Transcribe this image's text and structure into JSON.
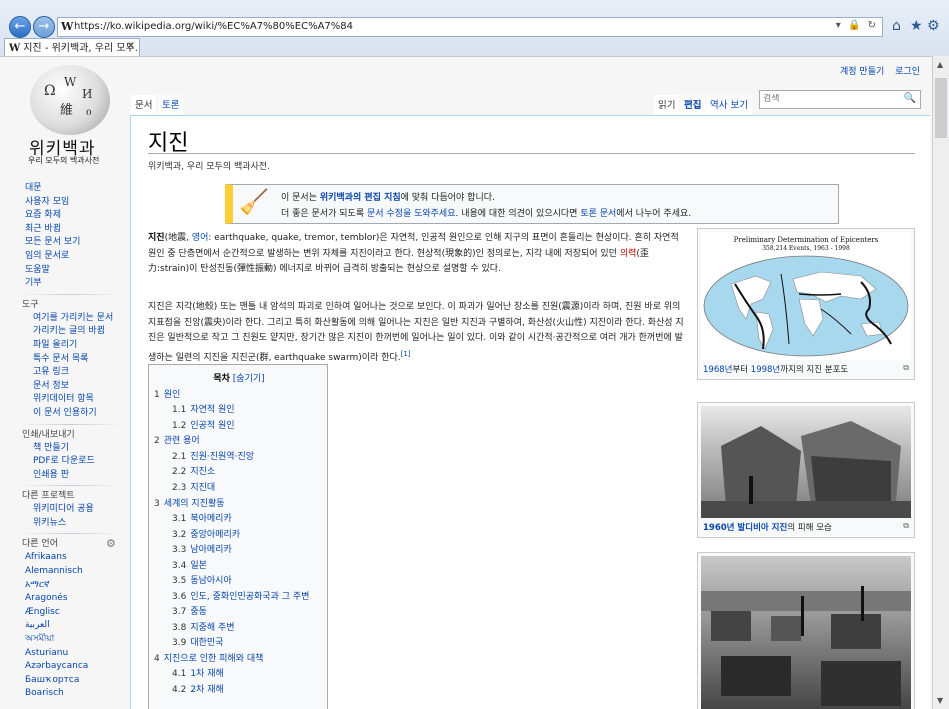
{
  "browser": {
    "url": "https://ko.wikipedia.org/wiki/%EC%A7%80%EC%A7%84",
    "url_controls": "▾ 🔒 ↻",
    "tab_title": "지진 - 위키백과, 우리 모두...",
    "tab_close": "✕",
    "back": "←",
    "forward": "→",
    "home_icon": "⌂",
    "fav_icon": "★",
    "settings_icon": "⚙"
  },
  "header": {
    "user_links": [
      "계정 만들기",
      "로그인"
    ],
    "ns_tabs": [
      "문서",
      "토론"
    ],
    "view_tabs": [
      "읽기",
      "편집",
      "역사 보기"
    ],
    "search_placeholder": "검색"
  },
  "sidebar": {
    "wiki_name": "위키백과",
    "wiki_sub": "우리 모두의 백과사전",
    "nav": [
      "대문",
      "사용자 모임",
      "요즘 화제",
      "최근 바뀜",
      "모든 문서 보기",
      "임의 문서로",
      "도움말",
      "기부"
    ],
    "tools_heading": "도구",
    "tools": [
      "여기를 가리키는 문서",
      "가리키는 글의 바뀜",
      "파일 올리기",
      "특수 문서 목록",
      "고유 링크",
      "문서 정보",
      "위키데이터 항목",
      "이 문서 인용하기"
    ],
    "print_heading": "인쇄/내보내기",
    "print": [
      "책 만들기",
      "PDF로 다운로드",
      "인쇄용 판"
    ],
    "projects_heading": "다른 프로젝트",
    "projects": [
      "위키미디어 공용",
      "위키뉴스"
    ],
    "lang_heading": "다른 언어",
    "languages": [
      "Afrikaans",
      "Alemannisch",
      "አማርኛ",
      "Aragonés",
      "Ænglisc",
      "العربية",
      "অসমীয়া",
      "Asturianu",
      "Azərbaycanca",
      "Башҡортса",
      "Boarisch"
    ]
  },
  "article": {
    "title": "지진",
    "tagline": "위키백과, 우리 모두의 백과사전.",
    "notice_line1_pre": "이 문서는 ",
    "notice_line1_link": "위키백과의 편집 지침",
    "notice_line1_post": "에 맞춰 다듬어야 합니다.",
    "notice_line2_pre": "더 좋은 문서가 되도록 ",
    "notice_line2_link1": "문서 수정을 도와주세요",
    "notice_line2_mid": ". 내용에 대한 의견이 있으시다면 ",
    "notice_line2_link2": "토론 문서",
    "notice_line2_post": "에서 나누어 주세요.",
    "p1_bold": "지진",
    "p1_a": "(地震, ",
    "p1_link": "영어",
    "p1_b": ": earthquake, quake, tremor, temblor)은 자연적, 인공적 원인으로 인해 지구의 표면이 흔들리는 현상이다. 흔히 자연적 원인 중 단층면에서 순간적으로 발생하는 변위 자체를 지진이라고 한다. 현상적(現象的)인 정의로는, 지각 내에 저장되어 있던 ",
    "p1_red": "의력",
    "p1_c": "(歪力:strain)이 탄성진동(彈性振動) 에너지로 바뀌어 급격히 방출되는 현상으로 설명할 수 있다.",
    "p2": "지진은 지각(地殼) 또는 맨틀 내 암석의 파괴로 인하여 일어나는 것으로 보인다. 이 파괴가 일어난 장소를 진원(震源)이라 하며, 진원 바로 위의 지표점을 진앙(震央)이라 한다. 그리고 특히 화산활동에 의해 일어나는 지진은 일반 지진과 구별하여, 화산성(火山性) 지진이라 한다. 화산성 지진은 일반적으로 작고 그 진원도 얕지만, 장기간 많은 지진이 한꺼번에 일어나는 일이 있다. 이와 같이 시간적·공간적으로 여러 개가 한꺼번에 발생하는 일련의 지진을 지진군(群, earthquake swarm)이라 한다.",
    "p2_ref": "[1]"
  },
  "toc": {
    "title": "목차",
    "toggle": "[숨기기]",
    "items": [
      {
        "num": "1",
        "label": "원인",
        "level": 1
      },
      {
        "num": "1.1",
        "label": "자연적 원인",
        "level": 2
      },
      {
        "num": "1.2",
        "label": "인공적 원인",
        "level": 2
      },
      {
        "num": "2",
        "label": "관련 용어",
        "level": 1
      },
      {
        "num": "2.1",
        "label": "진원·진원역·진앙",
        "level": 2
      },
      {
        "num": "2.2",
        "label": "지진소",
        "level": 2
      },
      {
        "num": "2.3",
        "label": "지진대",
        "level": 2
      },
      {
        "num": "3",
        "label": "세계의 지진활동",
        "level": 1
      },
      {
        "num": "3.1",
        "label": "북아메리카",
        "level": 2
      },
      {
        "num": "3.2",
        "label": "중앙아메리카",
        "level": 2
      },
      {
        "num": "3.3",
        "label": "남아메리카",
        "level": 2
      },
      {
        "num": "3.4",
        "label": "일본",
        "level": 2
      },
      {
        "num": "3.5",
        "label": "동남아시아",
        "level": 2
      },
      {
        "num": "3.6",
        "label": "인도, 중화인민공화국과 그 주변",
        "level": 2
      },
      {
        "num": "3.7",
        "label": "중동",
        "level": 2
      },
      {
        "num": "3.8",
        "label": "지중해 주변",
        "level": 2
      },
      {
        "num": "3.9",
        "label": "대한민국",
        "level": 2
      },
      {
        "num": "4",
        "label": "지진으로 인한 피해와 대책",
        "level": 1
      },
      {
        "num": "4.1",
        "label": "1차 재해",
        "level": 2
      },
      {
        "num": "4.2",
        "label": "2차 재해",
        "level": 2
      }
    ]
  },
  "images": {
    "map_title": "Preliminary Determination of Epicenters",
    "map_subtitle": "358,214 Events, 1963 - 1998",
    "cap1_link1": "1968년",
    "cap1_mid": "부터 ",
    "cap1_link2": "1998년",
    "cap1_post": "까지의 지진 분포도",
    "cap2_link": "1960년 발디비아 지진",
    "cap2_post": "의 피해 모습",
    "enlarge_icon": "⧉"
  },
  "colors": {
    "link": "#0645ad",
    "redlink": "#ba0000",
    "notice_bar": "#ffcc33"
  }
}
